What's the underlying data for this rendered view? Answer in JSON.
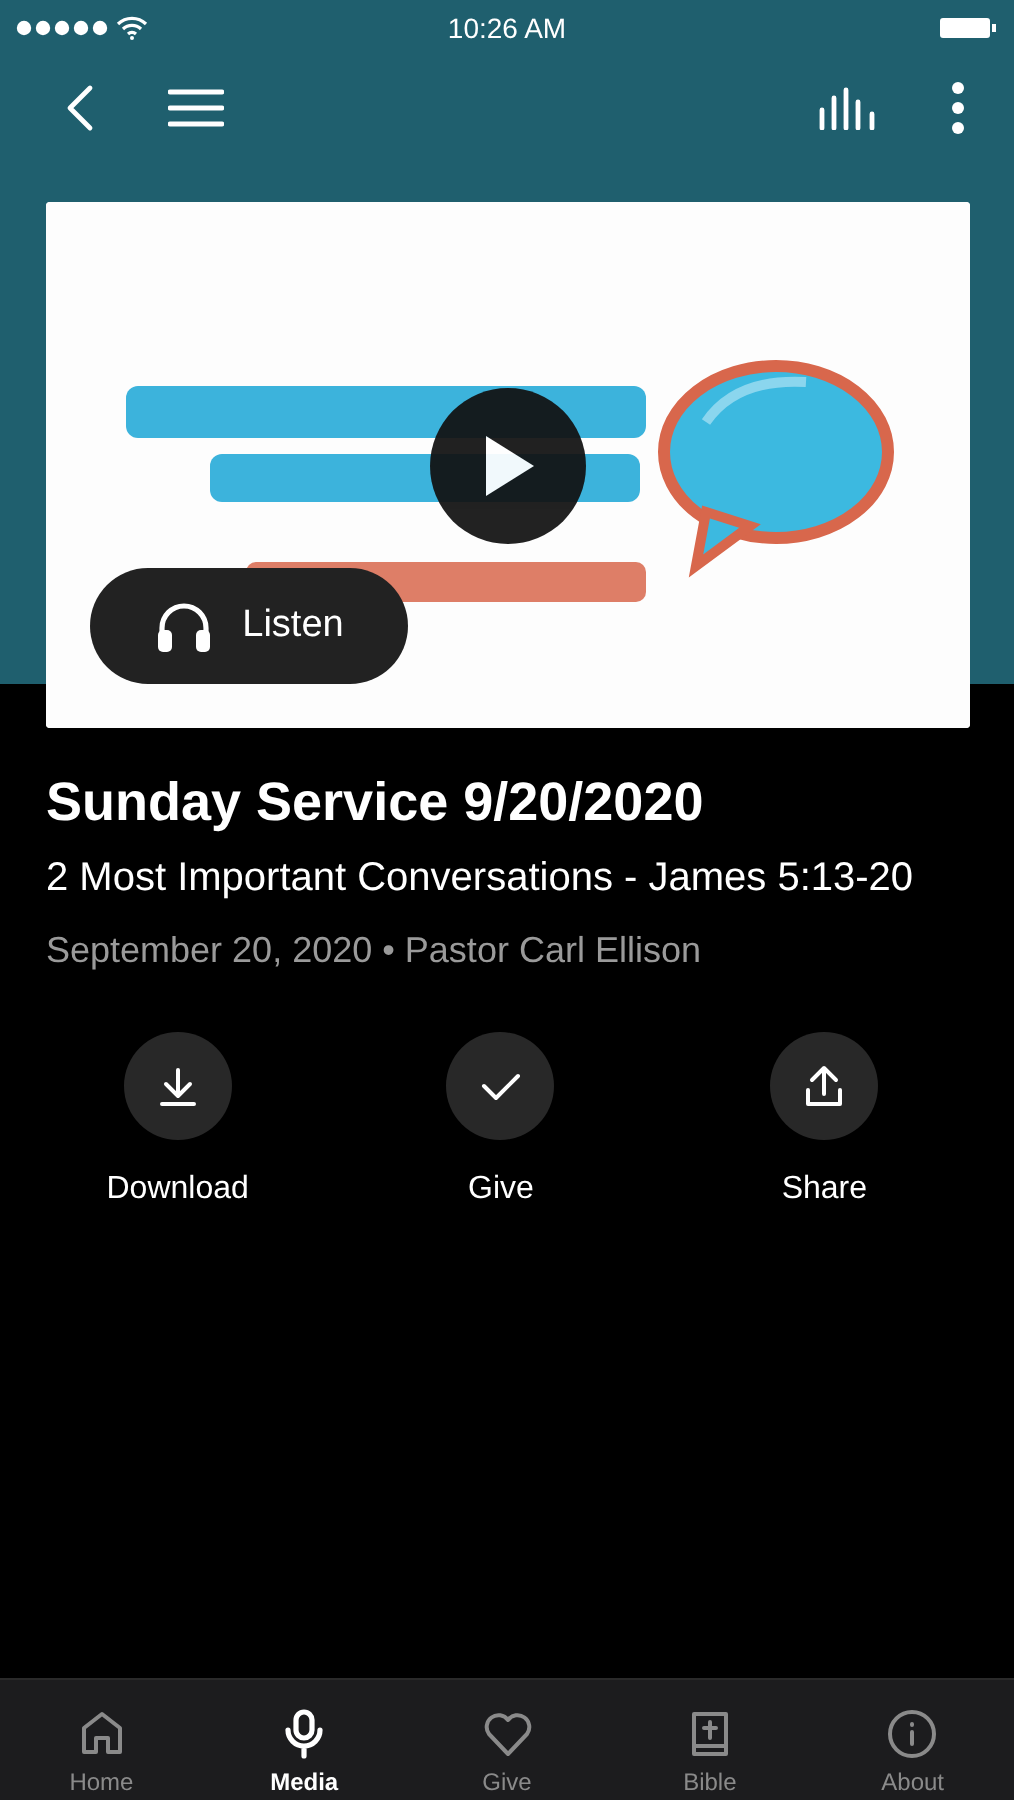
{
  "status_bar": {
    "time": "10:26 AM"
  },
  "media": {
    "kind": "picture",
    "listen_label": "Listen"
  },
  "title": "Sunday Service 9/20/2020",
  "subtitle": "2 Most Important Conversations - James 5:13-20",
  "meta": "September 20, 2020 • Pastor Carl Ellison",
  "actions": [
    {
      "label": "Download"
    },
    {
      "label": "Give"
    },
    {
      "label": "Share"
    }
  ],
  "tabs": [
    {
      "label": "Home",
      "selected": false
    },
    {
      "label": "Media",
      "selected": true
    },
    {
      "label": "Give",
      "selected": false
    },
    {
      "label": "Bible",
      "selected": false
    },
    {
      "label": "About",
      "selected": false
    }
  ]
}
